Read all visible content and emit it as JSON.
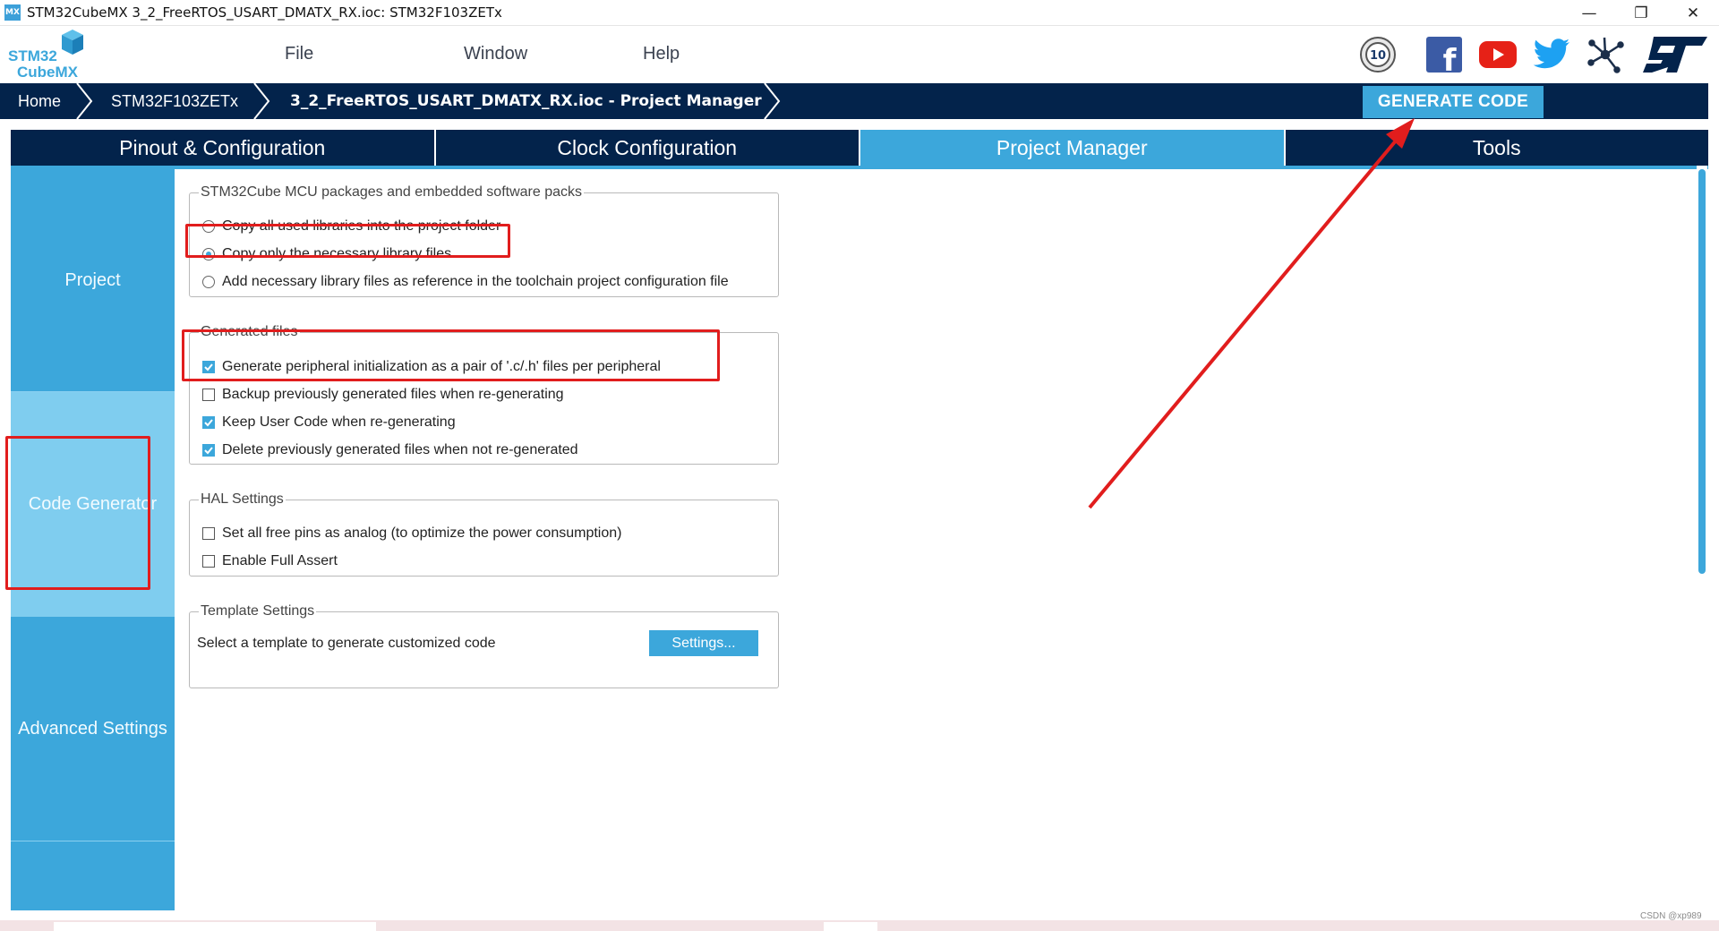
{
  "window": {
    "app_icon_text": "MX",
    "title": "STM32CubeMX 3_2_FreeRTOS_USART_DMATX_RX.ioc: STM32F103ZETx",
    "minimize": "—",
    "maximize": "❐",
    "close": "✕"
  },
  "logo": {
    "line1": "STM32",
    "line2": "CubeMX"
  },
  "menu": {
    "file": "File",
    "window": "Window",
    "help": "Help"
  },
  "social": {
    "badge_text": "10",
    "facebook_glyph": "f"
  },
  "breadcrumb": {
    "home": "Home",
    "device": "STM32F103ZETx",
    "project": "3_2_FreeRTOS_USART_DMATX_RX.ioc - Project Manager"
  },
  "generate_button": "GENERATE CODE",
  "tabs": [
    {
      "label": "Pinout & Configuration"
    },
    {
      "label": "Clock Configuration"
    },
    {
      "label": "Project Manager"
    },
    {
      "label": "Tools"
    }
  ],
  "sidebar": {
    "project": "Project",
    "code_generator": "Code Generator",
    "advanced": "Advanced Settings"
  },
  "mcu_packages": {
    "legend": "STM32Cube MCU packages and embedded software packs",
    "opt1": "Copy all used libraries into the project folder",
    "opt2": "Copy only the necessary library files",
    "opt3": "Add necessary library files as reference in the toolchain project configuration file"
  },
  "generated_files": {
    "legend": "Generated files",
    "opt1": "Generate peripheral initialization as a pair of '.c/.h' files per peripheral",
    "opt2": "Backup previously generated files when re-generating",
    "opt3": "Keep User Code when re-generating",
    "opt4": "Delete previously generated files when not re-generated"
  },
  "hal_settings": {
    "legend": "HAL Settings",
    "opt1": "Set all free pins as analog (to optimize the power consumption)",
    "opt2": "Enable Full Assert"
  },
  "template_settings": {
    "legend": "Template Settings",
    "text": "Select a template to generate customized code",
    "button": "Settings..."
  },
  "watermark": "CSDN @xp989",
  "colors": {
    "navy": "#03234b",
    "accent": "#3ca7db",
    "selected_side": "#7fcdef",
    "annotation_red": "#e11d1d"
  }
}
